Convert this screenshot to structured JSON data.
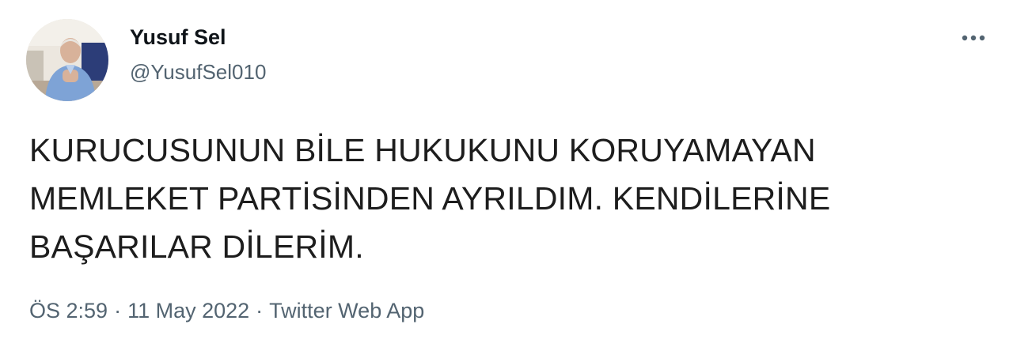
{
  "user": {
    "display_name": "Yusuf Sel",
    "handle": "@YusufSel010"
  },
  "tweet": {
    "text": "KURUCUSUNUN BİLE HUKUKUNU KORUYAMAYAN\nMEMLEKET PARTİSİNDEN AYRILDIM. KENDİLERİNE\nBAŞARILAR DİLERİM.",
    "time": "ÖS 2:59",
    "date": "11 May 2022",
    "separator": "·",
    "source": "Twitter Web App"
  },
  "icons": {
    "more": "more-options-icon",
    "avatar": "profile-photo"
  },
  "colors": {
    "primary_text": "#0f1419",
    "secondary_text": "#536471"
  }
}
